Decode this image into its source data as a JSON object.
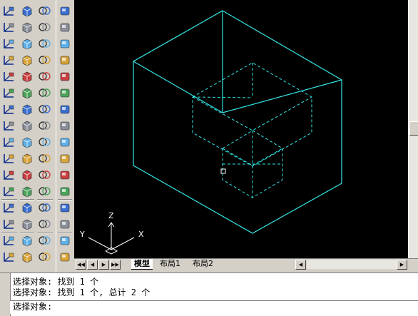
{
  "toolbars": {
    "col1": [
      "ucs",
      "ucs-world",
      "ucs-previous",
      "ucs-face",
      "ucs-object",
      "ucs-view",
      "ucs-origin",
      "ucs-zaxis",
      "ucs-3point",
      "ucs-x",
      "ucs-y",
      "ucs-z",
      "ucs-apply",
      "named-ucs",
      "ucs-manager",
      "ucs-extra"
    ],
    "col2": [
      "box",
      "wedge",
      "cone",
      "sphere",
      "cylinder",
      "torus",
      "pyramid",
      "dome",
      "dish",
      "mesh",
      "revolved-surface",
      "tabulated-surface",
      "ruled-surface",
      "edge-surface",
      "region",
      "3d-face"
    ],
    "col3": [
      "union",
      "subtract",
      "intersect",
      "extrude",
      "revolve",
      "slice",
      "section",
      "interference",
      "setup-drawing",
      "setup-view",
      "setup-profile",
      "solidedit",
      "render",
      "light",
      "material",
      "view"
    ],
    "col4": [
      "orbit",
      "sphere-solid",
      "cylinder-solid",
      "cone-solid",
      "wedge-solid",
      "torus-solid",
      "extrude-face",
      "move-face",
      "offset-face",
      "delete-face",
      "rotate-face",
      "taper-face",
      "copy-face",
      "color-face",
      "imprint",
      "shell"
    ]
  },
  "canvas": {
    "line_color": "#33e6e6",
    "ucs_axis_labels": [
      "Z",
      "Y",
      "X"
    ]
  },
  "layout_tabs": {
    "model": "模型",
    "layout1": "布局1",
    "layout2": "布局2"
  },
  "command": {
    "history": [
      "选择对象: 找到 1 个",
      "选择对象: 找到 1 个, 总计 2 个"
    ],
    "prompt": "选择对象:"
  }
}
